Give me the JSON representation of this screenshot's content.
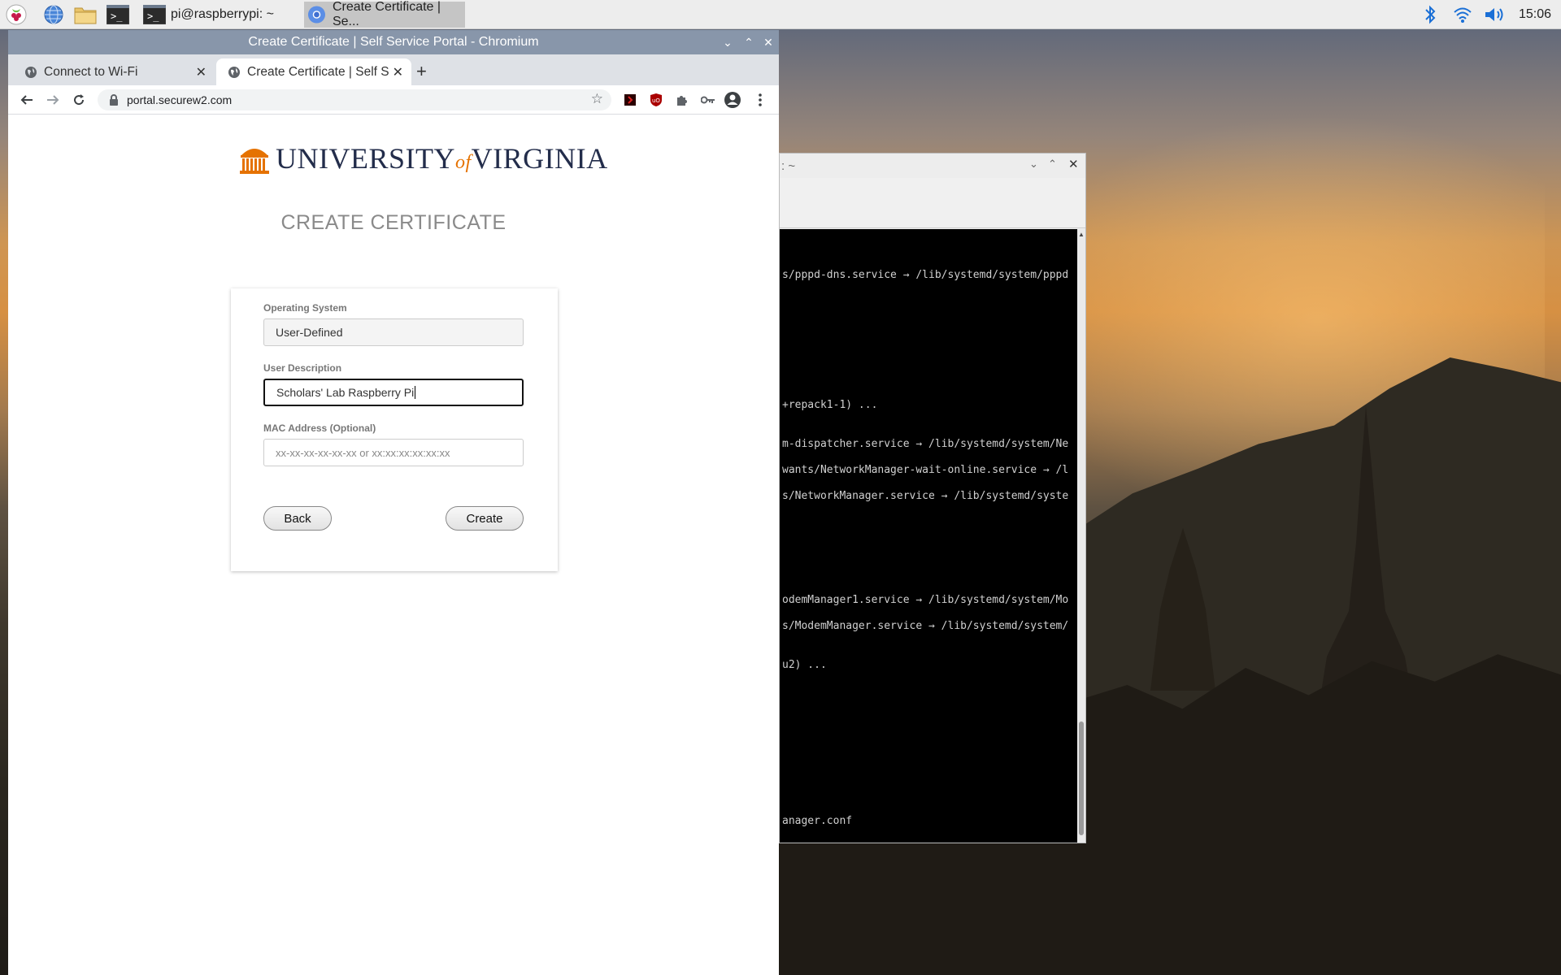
{
  "taskbar": {
    "tasks": [
      {
        "label": "pi@raspberrypi: ~"
      },
      {
        "label": "Create Certificate | Se..."
      }
    ],
    "clock": "15:06"
  },
  "browser": {
    "window_title": "Create Certificate | Self Service Portal - Chromium",
    "tabs": [
      {
        "label": "Connect to Wi-Fi"
      },
      {
        "label": "Create Certificate | Self S"
      }
    ],
    "url": "portal.securew2.com"
  },
  "page": {
    "logo_text": "UNIVERSITY of VIRGINIA",
    "logo_main": "UNIVERSITY",
    "logo_of": "of",
    "logo_state": "VIRGINIA",
    "heading": "CREATE CERTIFICATE",
    "form": {
      "os_label": "Operating System",
      "os_value": "User-Defined",
      "desc_label": "User Description",
      "desc_value": "Scholars' Lab Raspberry Pi",
      "mac_label": "MAC Address  (Optional)",
      "mac_placeholder": "xx-xx-xx-xx-xx-xx or xx:xx:xx:xx:xx:xx",
      "back_label": "Back",
      "create_label": "Create"
    }
  },
  "terminal": {
    "title": ": ~",
    "lines": [
      "s/pppd-dns.service → /lib/systemd/system/pppd",
      "+repack1-1) ...",
      "m-dispatcher.service → /lib/systemd/system/Ne",
      "wants/NetworkManager-wait-online.service → /l",
      "s/NetworkManager.service → /lib/systemd/syste",
      "odemManager1.service → /lib/systemd/system/Mo",
      "s/ModemManager.service → /lib/systemd/system/",
      "u2) ...",
      "anager.conf"
    ]
  }
}
